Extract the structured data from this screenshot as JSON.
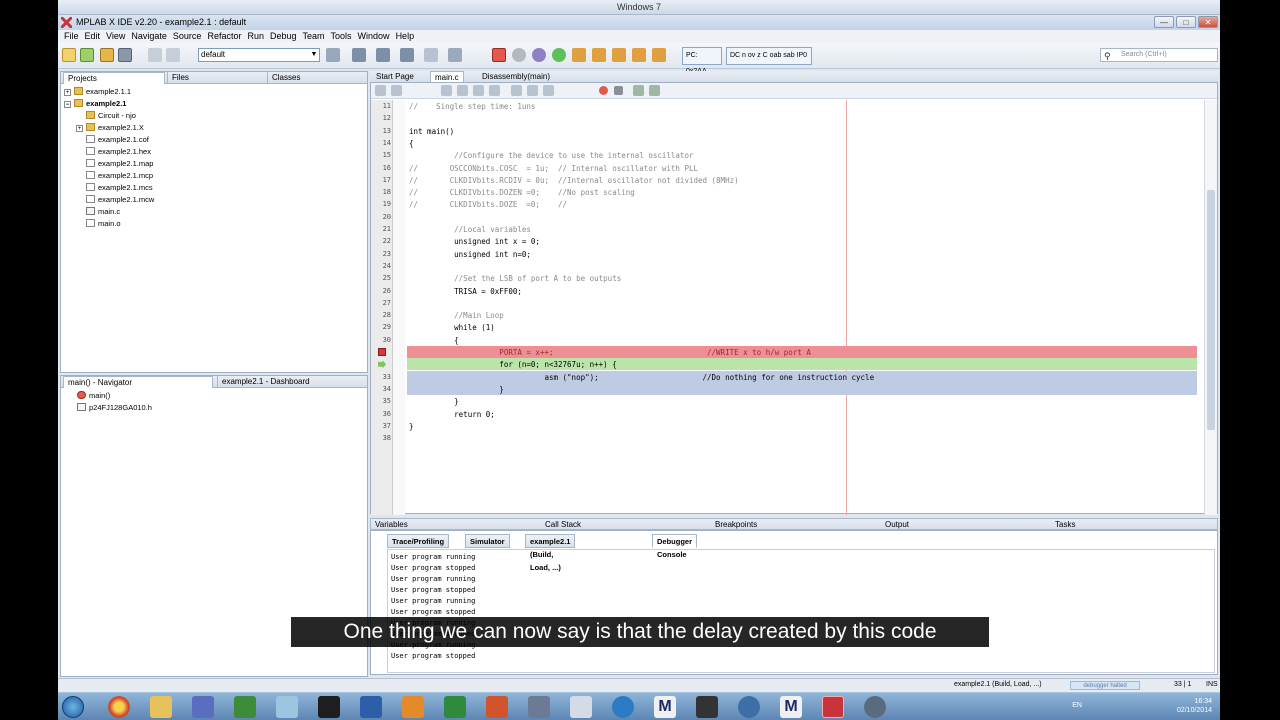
{
  "os": {
    "title": "Windows 7"
  },
  "window": {
    "title": "MPLAB X IDE v2.20 - example2.1 : default",
    "colors": {
      "accent": "#c8533c",
      "chrome": "#dfe6ee"
    }
  },
  "menu": [
    "File",
    "Edit",
    "View",
    "Navigate",
    "Source",
    "Refactor",
    "Run",
    "Debug",
    "Team",
    "Tools",
    "Window",
    "Help"
  ],
  "toolbar": {
    "config_value": "default",
    "pc_label": "PC: 0x2AA",
    "flags_label": "DC n ov z C oab sab IP0",
    "search_placeholder": "Search (Ctrl+I)"
  },
  "projects_pane": {
    "tabs": [
      "Projects",
      "Files",
      "Classes"
    ],
    "tree": [
      {
        "label": "example2.1.1",
        "type": "project"
      },
      {
        "label": "example2.1",
        "type": "project",
        "bold": true
      },
      {
        "label": "Circuit - njo",
        "type": "folder"
      },
      {
        "label": "example2.1.X",
        "type": "folder"
      },
      {
        "label": "example2.1.cof",
        "type": "file"
      },
      {
        "label": "example2.1.hex",
        "type": "file"
      },
      {
        "label": "example2.1.map",
        "type": "file"
      },
      {
        "label": "example2.1.mcp",
        "type": "file"
      },
      {
        "label": "example2.1.mcs",
        "type": "file"
      },
      {
        "label": "example2.1.mcw",
        "type": "file"
      },
      {
        "label": "main.c",
        "type": "source"
      },
      {
        "label": "main.o",
        "type": "file"
      }
    ]
  },
  "navigator_pane": {
    "tabs": [
      "main() - Navigator",
      "example2.1 - Dashboard"
    ],
    "items": [
      "main()",
      "p24FJ128GA010.h"
    ]
  },
  "editor": {
    "tabs": [
      "Start Page",
      "main.c",
      "Disassembly(main)"
    ],
    "lines": [
      {
        "n": "11",
        "text": "//    Single step time: 1uns",
        "kind": "comment"
      },
      {
        "n": "12",
        "text": "",
        "kind": "code"
      },
      {
        "n": "13",
        "text": "int main()",
        "kind": "code"
      },
      {
        "n": "14",
        "text": "{",
        "kind": "code"
      },
      {
        "n": "15",
        "text": "          //Configure the device to use the internal oscillator",
        "kind": "comment"
      },
      {
        "n": "16",
        "text": "//       OSCCONbits.COSC  = 1u;  // Internal oscillator with PLL",
        "kind": "comment"
      },
      {
        "n": "17",
        "text": "//       CLKDIVbits.RCDIV = 0u;  //Internal oscillator not divided (8MHz)",
        "kind": "comment"
      },
      {
        "n": "18",
        "text": "//       CLKDIVbits.DOZEN =0;    //No post scaling",
        "kind": "comment"
      },
      {
        "n": "19",
        "text": "//       CLKDIVbits.DOZE  =0;    //",
        "kind": "comment"
      },
      {
        "n": "20",
        "text": "",
        "kind": "code"
      },
      {
        "n": "21",
        "text": "          //Local variables",
        "kind": "comment"
      },
      {
        "n": "22",
        "text": "          unsigned int x = 0;",
        "kind": "code"
      },
      {
        "n": "23",
        "text": "          unsigned int n=0;",
        "kind": "code"
      },
      {
        "n": "24",
        "text": "",
        "kind": "code"
      },
      {
        "n": "25",
        "text": "          //Set the LSB of port A to be outputs",
        "kind": "comment"
      },
      {
        "n": "26",
        "text": "          TRISA = 0xFF00;",
        "kind": "code"
      },
      {
        "n": "27",
        "text": "",
        "kind": "code"
      },
      {
        "n": "28",
        "text": "          //Main Loop",
        "kind": "comment"
      },
      {
        "n": "29",
        "text": "          while (1)",
        "kind": "code"
      },
      {
        "n": "30",
        "text": "          {",
        "kind": "code"
      },
      {
        "n": "",
        "text": "                    PORTA = x++;                                  //WRITE x to h/w port A",
        "kind": "breakpoint"
      },
      {
        "n": "",
        "text": "                    for (n=0; n<32767u; n++) {",
        "kind": "current"
      },
      {
        "n": "33",
        "text": "                              asm (\"nop\");                       //Do nothing for one instruction cycle",
        "kind": "selected"
      },
      {
        "n": "34",
        "text": "                    }",
        "kind": "selected"
      },
      {
        "n": "35",
        "text": "          }",
        "kind": "code"
      },
      {
        "n": "36",
        "text": "          return 0;",
        "kind": "code"
      },
      {
        "n": "37",
        "text": "}",
        "kind": "code"
      },
      {
        "n": "38",
        "text": "",
        "kind": "code"
      }
    ]
  },
  "bottom_panels": {
    "tabs": [
      "Variables",
      "Call Stack",
      "Breakpoints",
      "Output",
      "Tasks"
    ]
  },
  "output": {
    "tabs": [
      "Trace/Profiling",
      "Simulator",
      "example2.1 (Build, Load, ...)",
      "Debugger Console"
    ],
    "console": [
      "User program running",
      "User program stopped",
      "User program running",
      "User program stopped",
      "User program running",
      "User program stopped",
      "User program running",
      "User program stopped",
      "User program running",
      "User program stopped"
    ]
  },
  "statusbar": {
    "project": "example2.1 (Build, Load, ...)",
    "state": "debugger halted",
    "position": "33 | 1",
    "mode": "INS"
  },
  "tray": {
    "lang": "EN",
    "time": "16:34",
    "date": "02/10/2014"
  },
  "caption": "One thing we can now say is that the delay created by this code"
}
